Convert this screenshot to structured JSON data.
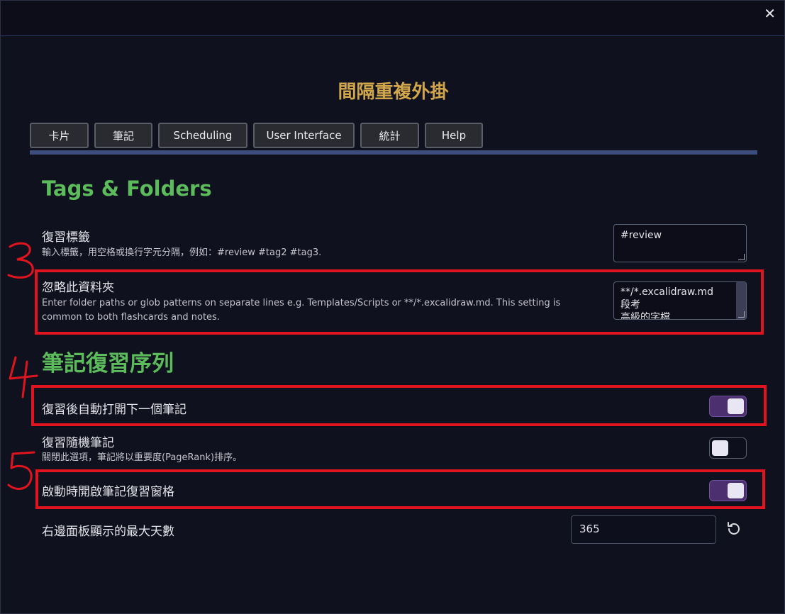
{
  "window": {
    "close_label": "✕"
  },
  "plugin_title": "間隔重複外掛",
  "tabs": [
    {
      "label": "卡片"
    },
    {
      "label": "筆記"
    },
    {
      "label": "Scheduling"
    },
    {
      "label": "User Interface"
    },
    {
      "label": "統計"
    },
    {
      "label": "Help"
    }
  ],
  "sections": {
    "tags_folders": {
      "heading": "Tags & Folders"
    },
    "note_review": {
      "heading": "筆記復習序列"
    }
  },
  "settings": {
    "review_tags": {
      "name": "復習標籤",
      "desc": "輸入標籤，用空格或換行字元分隔，例如：#review #tag2 #tag3.",
      "value": "#review"
    },
    "ignore_folders": {
      "name": "忽略此資料夾",
      "desc": "Enter folder paths or glob patterns on separate lines e.g. Templates/Scripts or **/*.excalidraw.md. This setting is common to both flashcards and notes.",
      "value_lines": [
        "**/*.excalidraw.md",
        "段考",
        "高級的字檔"
      ]
    },
    "auto_next_note": {
      "name": "復習後自動打開下一個筆記",
      "enabled": true
    },
    "random_note": {
      "name": "復習隨機筆記",
      "desc": "關閉此選項，筆記將以重要度(PageRank)排序。",
      "enabled": false
    },
    "open_pane_on_start": {
      "name": "啟動時開啟筆記復習窗格",
      "enabled": true
    },
    "max_days": {
      "name": "右邊面板顯示的最大天數",
      "value": "365"
    }
  },
  "annotations": {
    "mark_3": "3",
    "mark_4": "4",
    "mark_5": "5"
  },
  "colors": {
    "accent_toggle": "#4b2f6e",
    "heading_green": "#5cbc5b",
    "title_gold": "#d1a64a",
    "annotation_red": "#e0141e"
  }
}
